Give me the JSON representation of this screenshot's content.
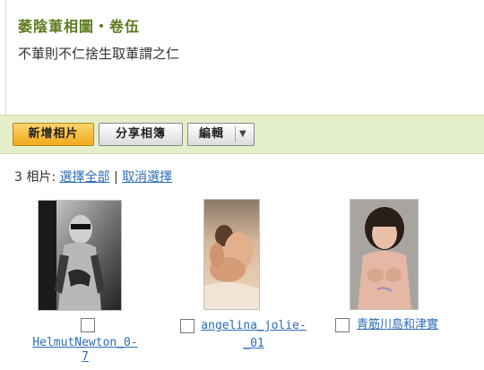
{
  "album": {
    "title": "萎陰莗相圖・卷伍",
    "description": "不莗則不仁捨生取莗謂之仁"
  },
  "toolbar": {
    "add_photos_label": "新增相片",
    "share_album_label": "分享相簿",
    "edit_label": "編輯",
    "edit_caret": "▼"
  },
  "selection": {
    "count_text": "3 相片:",
    "select_all_label": "選擇全部",
    "separator": "|",
    "deselect_label": "取消選擇"
  },
  "photos": [
    {
      "caption_line1": "HelmutNewton_0-",
      "caption_line2": "7",
      "checked": false
    },
    {
      "caption_line1": "angelina_jolie-",
      "caption_line2": "_01",
      "checked": false
    },
    {
      "caption_line1": "青筋川島和津實",
      "caption_line2": "",
      "checked": false
    }
  ]
}
